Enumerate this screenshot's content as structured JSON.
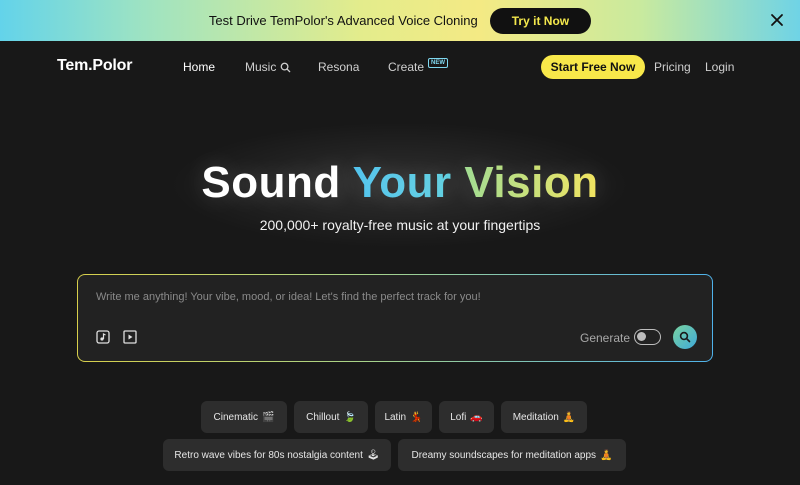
{
  "banner": {
    "text": "Test Drive TemPolor's Advanced Voice Cloning",
    "button_label": "Try it Now"
  },
  "nav": {
    "logo": "Tem.Polor",
    "items": [
      {
        "label": "Home"
      },
      {
        "label": "Music"
      },
      {
        "label": "Resona"
      },
      {
        "label": "Create"
      }
    ],
    "new_badge": "NEW",
    "start_button": "Start Free Now",
    "pricing": "Pricing",
    "login": "Login"
  },
  "hero": {
    "title_part1": "Sound",
    "title_part2": "Your",
    "title_part3": "Vision",
    "subtitle": "200,000+ royalty-free music at your fingertips"
  },
  "prompt": {
    "placeholder": "Write me anything! Your vibe, mood, or idea! Let's find the perfect track for you!",
    "generate_label": "Generate",
    "generate_enabled": false
  },
  "chips_row1": [
    {
      "label": "Cinematic",
      "emoji": "🎬"
    },
    {
      "label": "Chillout",
      "emoji": "🍃"
    },
    {
      "label": "Latin",
      "emoji": "💃"
    },
    {
      "label": "Lofi",
      "emoji": "🚗"
    },
    {
      "label": "Meditation",
      "emoji": "🧘"
    }
  ],
  "chips_row2": [
    {
      "label": "Retro wave vibes for 80s nostalgia content",
      "emoji": "🕹"
    },
    {
      "label": "Dreamy soundscapes for meditation apps",
      "emoji": "🧘"
    }
  ],
  "colors": {
    "accent_yellow": "#f8e84a",
    "accent_blue": "#4fc3ee",
    "background": "#181818"
  }
}
